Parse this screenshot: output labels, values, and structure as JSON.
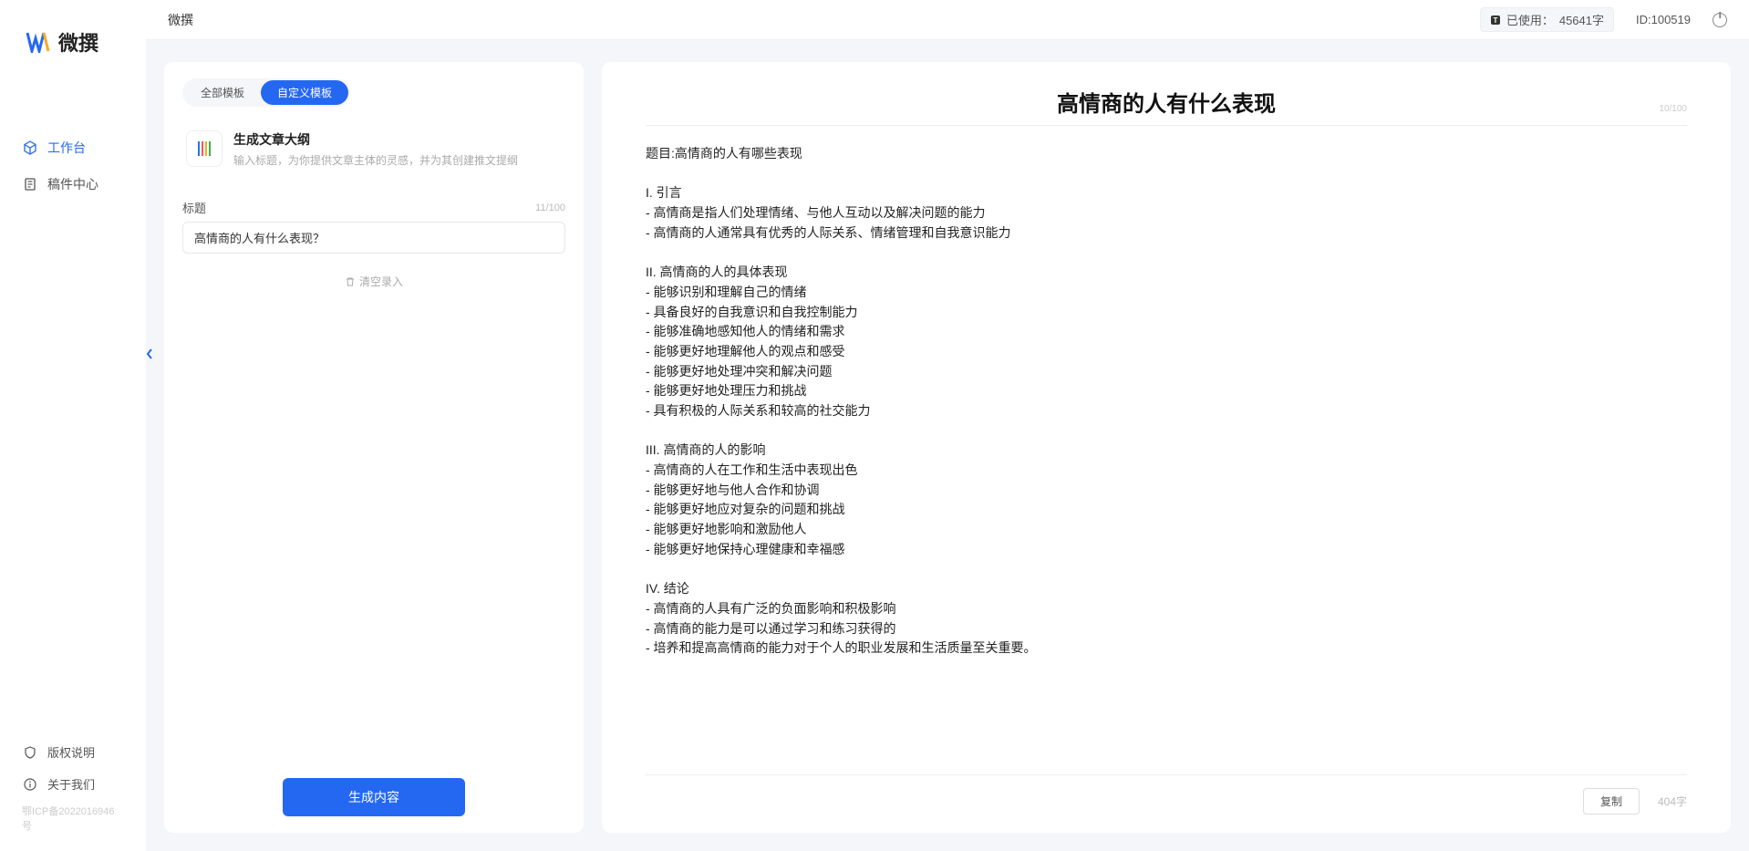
{
  "app": {
    "brand": "微撰",
    "topbar_title": "微撰"
  },
  "sidebar": {
    "items": [
      {
        "label": "工作台",
        "icon": "cube-icon",
        "active": true
      },
      {
        "label": "稿件中心",
        "icon": "document-icon",
        "active": false
      }
    ],
    "bottom": [
      {
        "label": "版权说明",
        "icon": "shield-icon"
      },
      {
        "label": "关于我们",
        "icon": "info-icon"
      }
    ],
    "icp": "鄂ICP备2022016946号"
  },
  "header": {
    "usage_prefix": "已使用：",
    "usage_value": "45641字",
    "user_id_label": "ID:100519"
  },
  "left_panel": {
    "tabs": [
      {
        "label": "全部模板",
        "active": false
      },
      {
        "label": "自定义模板",
        "active": true
      }
    ],
    "template": {
      "title": "生成文章大纲",
      "desc": "输入标题，为你提供文章主体的灵感，并为其创建推文提纲"
    },
    "field_label": "标题",
    "char_count": "11/100",
    "title_value": "高情商的人有什么表现？",
    "clear_label": "清空录入",
    "generate_label": "生成内容"
  },
  "right_panel": {
    "title": "高情商的人有什么表现",
    "title_count": "10/100",
    "body": "题目:高情商的人有哪些表现\n\nI. 引言\n- 高情商是指人们处理情绪、与他人互动以及解决问题的能力\n- 高情商的人通常具有优秀的人际关系、情绪管理和自我意识能力\n\nII. 高情商的人的具体表现\n- 能够识别和理解自己的情绪\n- 具备良好的自我意识和自我控制能力\n- 能够准确地感知他人的情绪和需求\n- 能够更好地理解他人的观点和感受\n- 能够更好地处理冲突和解决问题\n- 能够更好地处理压力和挑战\n- 具有积极的人际关系和较高的社交能力\n\nIII. 高情商的人的影响\n- 高情商的人在工作和生活中表现出色\n- 能够更好地与他人合作和协调\n- 能够更好地应对复杂的问题和挑战\n- 能够更好地影响和激励他人\n- 能够更好地保持心理健康和幸福感\n\nIV. 结论\n- 高情商的人具有广泛的负面影响和积极影响\n- 高情商的能力是可以通过学习和练习获得的\n- 培养和提高高情商的能力对于个人的职业发展和生活质量至关重要。",
    "copy_label": "复制",
    "word_count": "404字"
  }
}
